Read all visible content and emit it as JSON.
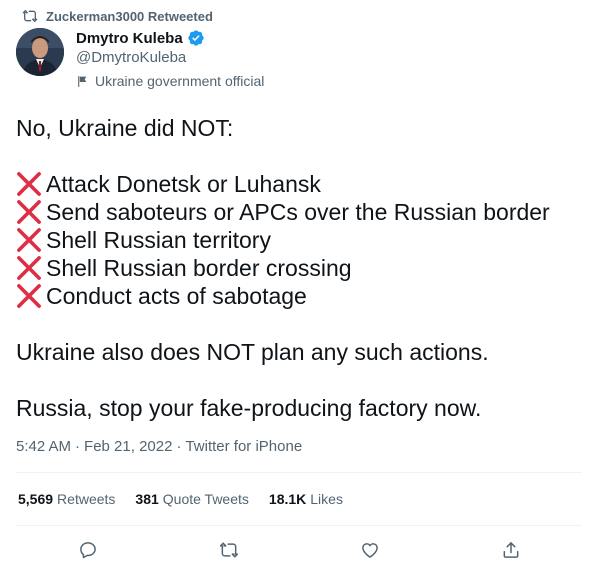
{
  "retweet": {
    "text": "Zuckerman3000 Retweeted"
  },
  "author": {
    "name": "Dmytro Kuleba",
    "handle": "@DmytroKuleba",
    "label": "Ukraine government official"
  },
  "tweet": {
    "intro": "No, Ukraine did NOT:",
    "items": [
      "Attack Donetsk or Luhansk",
      "Send saboteurs or APCs over the Russian border",
      "Shell Russian territory",
      "Shell Russian border crossing",
      "Conduct acts of sabotage"
    ],
    "para2": "Ukraine also does NOT plan any such actions.",
    "para3": "Russia, stop your fake-producing factory now."
  },
  "meta": {
    "time": "5:42 AM",
    "sep1": "·",
    "date": "Feb 21, 2022",
    "sep2": "·",
    "source": "Twitter for iPhone"
  },
  "stats": {
    "retweets_count": "5,569",
    "retweets_label": "Retweets",
    "quotes_count": "381",
    "quotes_label": "Quote Tweets",
    "likes_count": "18.1K",
    "likes_label": "Likes"
  },
  "icons": {
    "retweet": "retweet-icon",
    "verified": "verified-badge-icon",
    "flag": "flag-icon",
    "x_mark": "cross-mark-icon",
    "reply": "reply-icon",
    "like": "heart-icon",
    "share": "share-icon"
  },
  "colors": {
    "text": "#0f1419",
    "secondary": "#536471",
    "verified": "#1d9bf0",
    "cross": "#dd2e44",
    "divider": "#eff3f4"
  }
}
